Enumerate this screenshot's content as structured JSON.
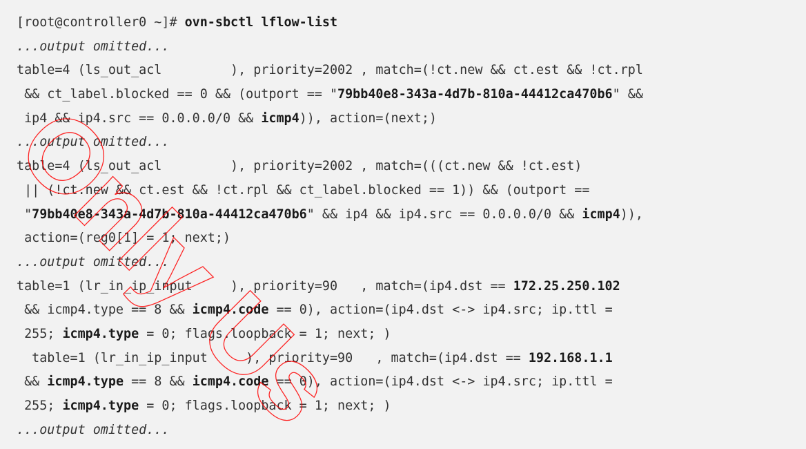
{
  "terminal": {
    "background": "#f2f2f2",
    "text_color": "#333333",
    "lines": [
      [
        {
          "t": "[root@controller0 ~]# "
        },
        {
          "t": "ovn-sbctl lflow-list",
          "s": "strong"
        }
      ],
      [
        {
          "t": "...output omitted...",
          "s": "em"
        }
      ],
      [
        {
          "t": "table=4 (ls_out_acl         ), priority=2002 , match=(!ct.new && ct.est && !ct.rpl"
        }
      ],
      [
        {
          "t": " && ct_label.blocked == 0 && (outport == \""
        },
        {
          "t": "79bb40e8-343a-4d7b-810a-44412ca470b6",
          "s": "strong"
        },
        {
          "t": "\" &&"
        }
      ],
      [
        {
          "t": " ip4 && ip4.src == 0.0.0.0/0 && "
        },
        {
          "t": "icmp4",
          "s": "strong"
        },
        {
          "t": ")), action=(next;)"
        }
      ],
      [
        {
          "t": "...output omitted...",
          "s": "em"
        }
      ],
      [
        {
          "t": "table=4 (ls_out_acl         ), priority=2002 , match=(((ct.new && !ct.est)"
        }
      ],
      [
        {
          "t": " || (!ct.new && ct.est && !ct.rpl && ct_label.blocked == 1)) && (outport =="
        }
      ],
      [
        {
          "t": " \""
        },
        {
          "t": "79bb40e8-343a-4d7b-810a-44412ca470b6",
          "s": "strong"
        },
        {
          "t": "\" && ip4 && ip4.src == 0.0.0.0/0 && "
        },
        {
          "t": "icmp4",
          "s": "strong"
        },
        {
          "t": ")),"
        }
      ],
      [
        {
          "t": " action=(reg0[1] = 1; next;)"
        }
      ],
      [
        {
          "t": "...output omitted...",
          "s": "em"
        }
      ],
      [
        {
          "t": "table=1 (lr_in_ip_input     ), priority=90   , match=(ip4.dst == "
        },
        {
          "t": "172.25.250.102",
          "s": "strong"
        }
      ],
      [
        {
          "t": " && icmp4.type == 8 && "
        },
        {
          "t": "icmp4.code",
          "s": "strong"
        },
        {
          "t": " == 0), action=(ip4.dst <-> ip4.src; ip.ttl ="
        }
      ],
      [
        {
          "t": " 255; "
        },
        {
          "t": "icmp4.type",
          "s": "strong"
        },
        {
          "t": " = 0; flags.loopback = 1; next; )"
        }
      ],
      [
        {
          "t": "  table=1 (lr_in_ip_input     ), priority=90   , match=(ip4.dst == "
        },
        {
          "t": "192.168.1.1",
          "s": "strong"
        }
      ],
      [
        {
          "t": " && "
        },
        {
          "t": "icmp4.type",
          "s": "strong"
        },
        {
          "t": " == 8 && "
        },
        {
          "t": "icmp4.code",
          "s": "strong"
        },
        {
          "t": " == 0), action=(ip4.dst <-> ip4.src; ip.ttl ="
        }
      ],
      [
        {
          "t": " 255; "
        },
        {
          "t": "icmp4.type",
          "s": "strong"
        },
        {
          "t": " = 0; flags.loopback = 1; next; )"
        }
      ],
      [
        {
          "t": "...output omitted...",
          "s": "em"
        }
      ]
    ]
  },
  "watermark": {
    "text": "Only Us",
    "color": "#ff0000",
    "opacity": 0.85
  }
}
